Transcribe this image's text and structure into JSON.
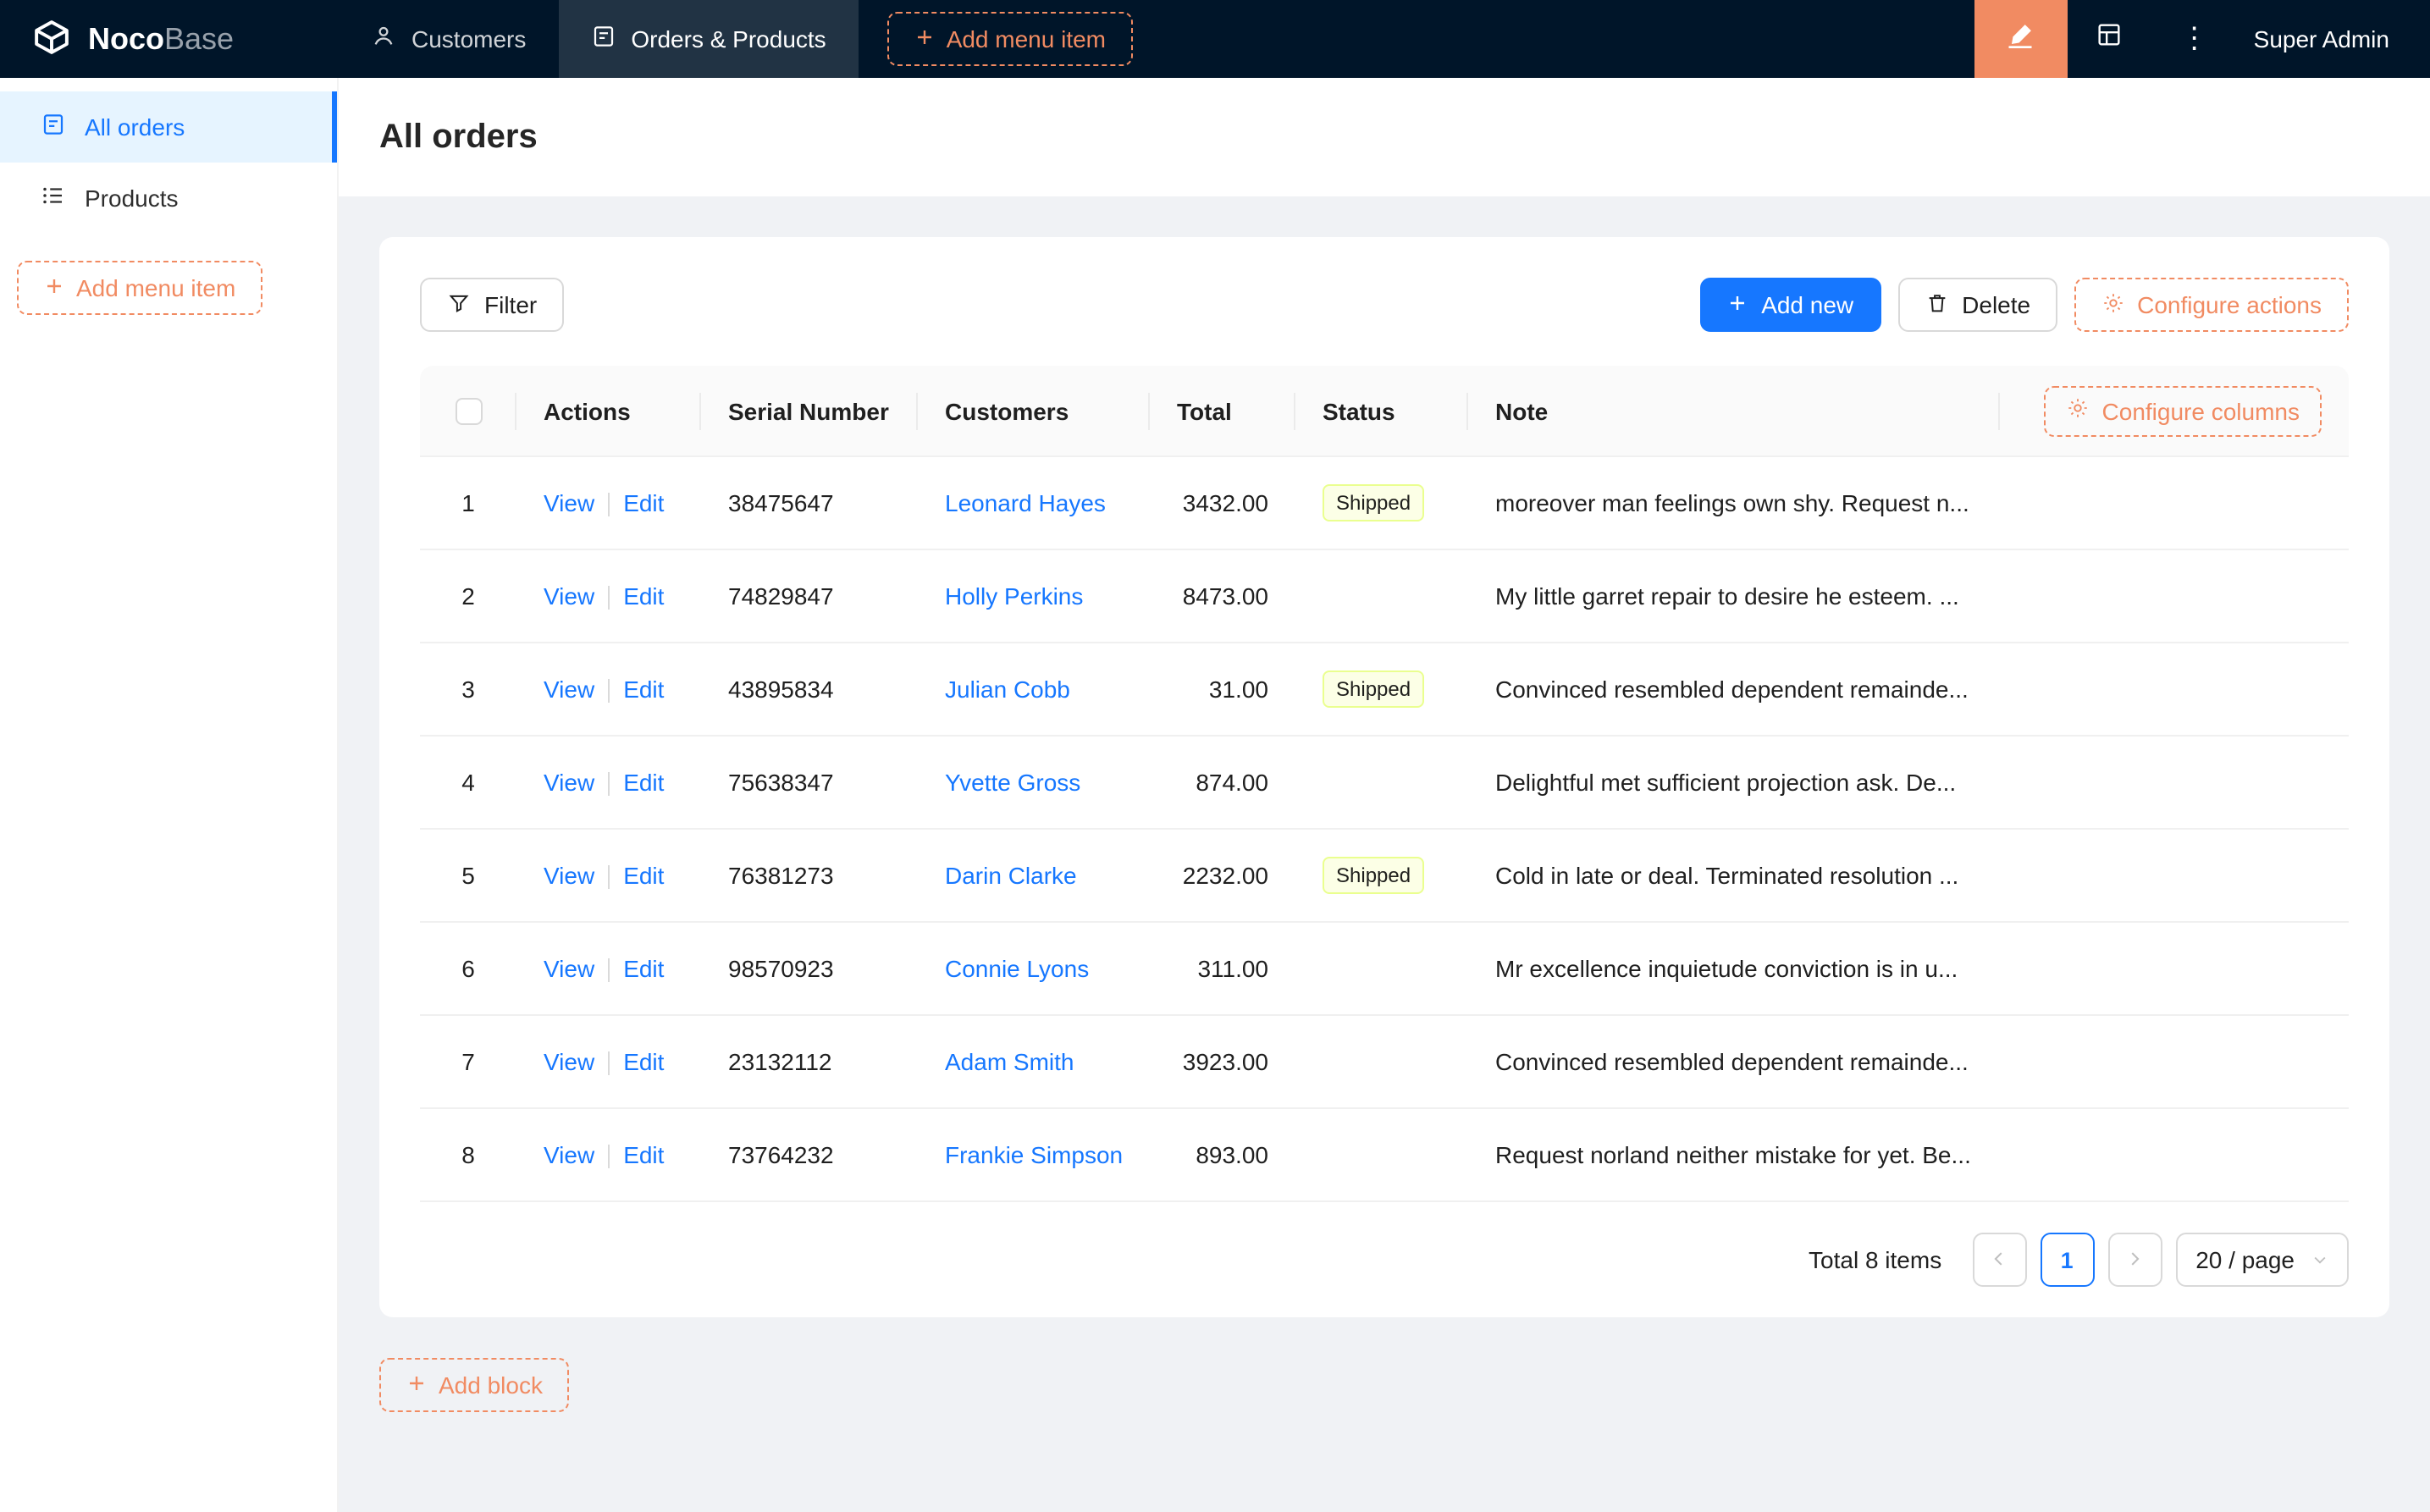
{
  "header": {
    "logo_bold": "Noco",
    "logo_light": "Base",
    "nav": [
      {
        "label": "Customers"
      },
      {
        "label": "Orders & Products"
      }
    ],
    "add_menu_item_label": "Add menu item",
    "more_icon": "⋮",
    "user_name": "Super Admin"
  },
  "sidebar": {
    "items": [
      {
        "label": "All orders"
      },
      {
        "label": "Products"
      }
    ],
    "add_menu_item_label": "Add menu item"
  },
  "page": {
    "title": "All orders"
  },
  "toolbar": {
    "filter_label": "Filter",
    "add_new_label": "Add new",
    "delete_label": "Delete",
    "configure_actions_label": "Configure actions"
  },
  "table": {
    "columns": {
      "actions": "Actions",
      "serial_number": "Serial Number",
      "customers": "Customers",
      "total": "Total",
      "status": "Status",
      "note": "Note"
    },
    "configure_columns_label": "Configure columns",
    "view_label": "View",
    "edit_label": "Edit",
    "rows": [
      {
        "index": 1,
        "serial_number": "38475647",
        "customer": "Leonard Hayes",
        "total": "3432.00",
        "status": "Shipped",
        "note": "moreover man feelings own shy. Request n..."
      },
      {
        "index": 2,
        "serial_number": "74829847",
        "customer": "Holly Perkins",
        "total": "8473.00",
        "status": "",
        "note": "My little garret repair to desire he esteem. ..."
      },
      {
        "index": 3,
        "serial_number": "43895834",
        "customer": "Julian Cobb",
        "total": "31.00",
        "status": "Shipped",
        "note": "Convinced resembled dependent remainde..."
      },
      {
        "index": 4,
        "serial_number": "75638347",
        "customer": "Yvette Gross",
        "total": "874.00",
        "status": "",
        "note": "Delightful met sufficient projection ask. De..."
      },
      {
        "index": 5,
        "serial_number": "76381273",
        "customer": "Darin Clarke",
        "total": "2232.00",
        "status": "Shipped",
        "note": "Cold in late or deal. Terminated resolution ..."
      },
      {
        "index": 6,
        "serial_number": "98570923",
        "customer": "Connie Lyons",
        "total": "311.00",
        "status": "",
        "note": "Mr excellence inquietude conviction is in u..."
      },
      {
        "index": 7,
        "serial_number": "23132112",
        "customer": "Adam Smith",
        "total": "3923.00",
        "status": "",
        "note": "Convinced resembled dependent remainde..."
      },
      {
        "index": 8,
        "serial_number": "73764232",
        "customer": "Frankie Simpson",
        "total": "893.00",
        "status": "",
        "note": "Request norland neither mistake for yet. Be..."
      }
    ]
  },
  "pagination": {
    "total_text": "Total 8 items",
    "current_page": "1",
    "page_size_label": "20 / page"
  },
  "add_block_label": "Add block",
  "colors": {
    "navbar_bg": "#001529",
    "accent_orange": "#F18B62",
    "primary_blue": "#1677FF",
    "active_menu_bg": "#E6F4FF",
    "status_shipped_bg": "#FCFFE6",
    "status_shipped_border": "#EAFF8F",
    "content_bg": "#F0F2F5"
  }
}
